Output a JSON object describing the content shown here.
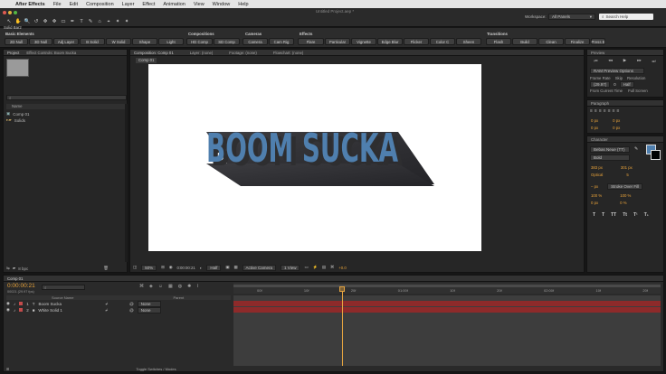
{
  "menu": {
    "apple": "",
    "app": "After Effects",
    "items": [
      "File",
      "Edit",
      "Composition",
      "Layer",
      "Effect",
      "Animation",
      "View",
      "Window",
      "Help"
    ]
  },
  "doc_title": "Untitled Project.aep *",
  "toolbar": {
    "tools": [
      "↖",
      "✋",
      "🔍",
      "↺",
      "✥",
      "✥",
      "▭",
      "✒",
      "T",
      "✎",
      "⌂",
      "⌖",
      "✦",
      "✦"
    ],
    "workspace_label": "Workspace:",
    "workspace_value": "All Panels",
    "help_search": "Search Help"
  },
  "script_panel": {
    "tab": "Solid Bar2",
    "sections": {
      "basic": "Basic Elements",
      "compositions": "Compositions",
      "cameras": "Cameras",
      "effects": "Effects",
      "transitions": "Transitions"
    },
    "buttons": [
      "2D Null",
      "3D Null",
      "Adj Layer",
      "B Solid",
      "W Solid",
      "Shape",
      "Light",
      "HD Comp",
      "SD Comp",
      "Camera",
      "Cam Rig",
      "Flare",
      "Particular",
      "Vignette",
      "Edge Blur",
      "Flicker",
      "Color C",
      "Sheen",
      "Flash",
      "Build",
      "Clean",
      "Finalize",
      "Press E"
    ]
  },
  "project_panel": {
    "tabs": [
      "Project",
      "Effect Controls: Boom Sucka"
    ],
    "search_placeholder": "⌕",
    "column_name": "Name",
    "items": [
      "Comp 01",
      "Solids"
    ],
    "bpc": "8 bpc"
  },
  "comp_panel": {
    "tabs": [
      "Composition: Comp 01",
      "Layer: (none)",
      "Footage: (none)",
      "Flowchart: (none)"
    ],
    "comp_tab": "Comp 01",
    "artwork_text": "BOOM SUCKA",
    "zoom": "50%",
    "timecode": "0:00:00:21",
    "resolution": "Half",
    "camera": "Active Camera",
    "views": "1 View",
    "exposure": "+0.0"
  },
  "preview": {
    "title": "Preview",
    "ram_options": "RAM Preview Options",
    "frame_rate_label": "Frame Rate",
    "skip_label": "Skip",
    "resolution_label": "Resolution",
    "frame_rate": "(29.97)",
    "skip": "0",
    "resolution": "Half",
    "from_current": "From Current Time",
    "full_screen": "Full Screen"
  },
  "paragraph": {
    "title": "Paragraph",
    "values": [
      "0 px",
      "0 px",
      "0 px",
      "0 px",
      "0 px"
    ]
  },
  "character": {
    "title": "Character",
    "font": "Bebas Neue (TT)",
    "style": "Bold",
    "size": "383 px",
    "leading": "301 px",
    "kerning": "Optical",
    "tracking": "5",
    "stroke_width": "– px",
    "stroke_type": "Stroke Over Fill",
    "vscale": "100 %",
    "hscale": "100 %",
    "baseline": "0 px",
    "tsume": "0 %",
    "styles": [
      "T",
      "T",
      "TT",
      "Tt",
      "T¹",
      "T₁"
    ]
  },
  "timeline": {
    "tab": "Comp 01",
    "timecode": "0:00:00:21",
    "fps": "00021 (29.97 fps)",
    "col_source": "Source Name",
    "col_parent": "Parent",
    "layers": [
      {
        "num": "1",
        "name": "Boom Sucka",
        "type": "T",
        "parent": "None"
      },
      {
        "num": "2",
        "name": "White Solid 1",
        "type": "■",
        "parent": "None"
      }
    ],
    "ruler": [
      "00f",
      "10f",
      "20f",
      "01:00f",
      "10f",
      "20f",
      "02:00f",
      "10f",
      "20f"
    ],
    "toggle": "Toggle Switches / Modes"
  },
  "colors": {
    "boom_blue": "#4f7fae",
    "boom_shadow": "#2e2e30",
    "clip_red": "#8e2a2a",
    "playhead": "#e3a340"
  }
}
